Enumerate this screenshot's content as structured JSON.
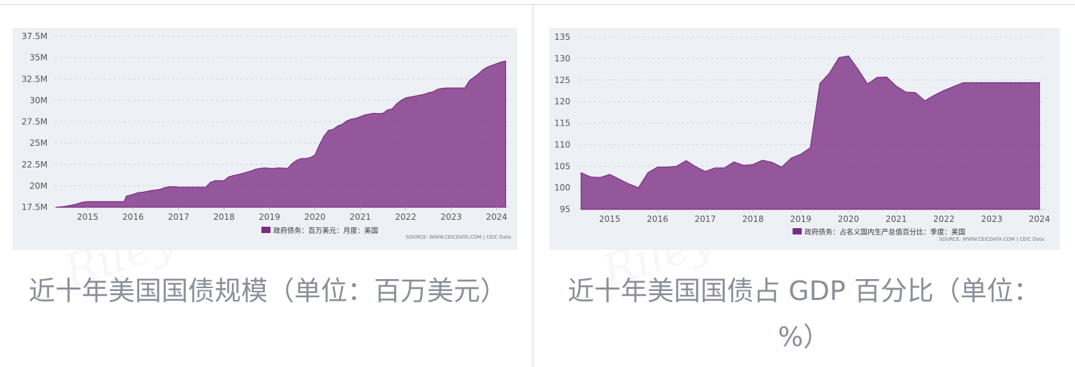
{
  "watermark": "Riley",
  "charts": [
    {
      "caption": "近十年美国国债规模（单位：百万美元）",
      "legend": "政府债务：百万美元：月度：美国",
      "source": "SOURCE: WWW.CEICDATA.COM | CEIC Data",
      "color": "#7b2b82",
      "chart_data": {
        "type": "area",
        "yticks": [
          "17.5M",
          "20M",
          "22.5M",
          "25M",
          "27.5M",
          "30M",
          "32.5M",
          "35M",
          "37.5M"
        ],
        "ytick_values": [
          17.5,
          20,
          22.5,
          25,
          27.5,
          30,
          32.5,
          35,
          37.5
        ],
        "xticks": [
          "2015",
          "2016",
          "2017",
          "2018",
          "2019",
          "2020",
          "2021",
          "2022",
          "2023",
          "2024"
        ],
        "ylim": [
          17.5,
          37.5
        ],
        "xlim": [
          2014.27,
          2024.3
        ],
        "x": [
          2014.3,
          2014.5,
          2014.7,
          2014.8,
          2014.9,
          2015.0,
          2015.1,
          2015.3,
          2015.5,
          2015.7,
          2015.8,
          2015.85,
          2016.0,
          2016.1,
          2016.2,
          2016.4,
          2016.6,
          2016.7,
          2016.8,
          2016.9,
          2017.0,
          2017.1,
          2017.3,
          2017.5,
          2017.6,
          2017.7,
          2017.8,
          2017.9,
          2018.0,
          2018.1,
          2018.2,
          2018.3,
          2018.5,
          2018.6,
          2018.7,
          2018.8,
          2018.9,
          2019.0,
          2019.1,
          2019.2,
          2019.4,
          2019.5,
          2019.6,
          2019.7,
          2019.8,
          2019.9,
          2020.0,
          2020.1,
          2020.2,
          2020.3,
          2020.4,
          2020.5,
          2020.6,
          2020.7,
          2020.8,
          2020.9,
          2021.0,
          2021.1,
          2021.2,
          2021.3,
          2021.4,
          2021.5,
          2021.6,
          2021.7,
          2021.8,
          2021.9,
          2022.0,
          2022.1,
          2022.2,
          2022.3,
          2022.4,
          2022.5,
          2022.6,
          2022.7,
          2022.8,
          2022.9,
          2023.0,
          2023.1,
          2023.2,
          2023.3,
          2023.4,
          2023.5,
          2023.6,
          2023.7,
          2023.8,
          2023.9,
          2024.0,
          2024.1,
          2024.2
        ],
        "y": [
          17.5,
          17.6,
          17.8,
          17.95,
          18.1,
          18.15,
          18.15,
          18.15,
          18.15,
          18.15,
          18.15,
          18.8,
          19.0,
          19.2,
          19.25,
          19.45,
          19.6,
          19.8,
          19.9,
          19.9,
          19.85,
          19.85,
          19.85,
          19.85,
          19.85,
          20.4,
          20.6,
          20.6,
          20.6,
          21.05,
          21.2,
          21.3,
          21.6,
          21.75,
          21.95,
          22.05,
          22.1,
          22.05,
          22.05,
          22.1,
          22.05,
          22.6,
          23.0,
          23.2,
          23.2,
          23.3,
          23.6,
          24.8,
          25.8,
          26.5,
          26.6,
          27.0,
          27.2,
          27.6,
          27.8,
          27.9,
          28.1,
          28.3,
          28.4,
          28.5,
          28.45,
          28.5,
          28.9,
          29.0,
          29.6,
          30.0,
          30.3,
          30.4,
          30.5,
          30.6,
          30.7,
          30.9,
          31.0,
          31.3,
          31.4,
          31.45,
          31.45,
          31.45,
          31.45,
          31.45,
          32.3,
          32.7,
          33.1,
          33.6,
          33.9,
          34.1,
          34.3,
          34.5,
          34.6
        ]
      }
    },
    {
      "caption": "近十年美国国债占 GDP 百分比（单位：%）",
      "legend": "政府债务：占名义国内生产总值百分比：季度：美国",
      "source": "SOURCE: WWW.CEICDATA.COM | CEIC Data",
      "color": "#7b2b82",
      "chart_data": {
        "type": "area",
        "yticks": [
          "95",
          "100",
          "105",
          "110",
          "115",
          "120",
          "125",
          "130",
          "135"
        ],
        "ytick_values": [
          95,
          100,
          105,
          110,
          115,
          120,
          125,
          130,
          135
        ],
        "xticks": [
          "2015",
          "2016",
          "2017",
          "2018",
          "2019",
          "2020",
          "2021",
          "2022",
          "2023",
          "2024"
        ],
        "ylim": [
          95,
          135
        ],
        "xlim": [
          2014.35,
          2024.1
        ],
        "x": [
          2014.4,
          2014.6,
          2014.8,
          2015.0,
          2015.2,
          2015.4,
          2015.6,
          2015.8,
          2016.0,
          2016.2,
          2016.4,
          2016.6,
          2016.8,
          2017.0,
          2017.2,
          2017.4,
          2017.6,
          2017.8,
          2018.0,
          2018.2,
          2018.4,
          2018.6,
          2018.8,
          2019.0,
          2019.2,
          2019.4,
          2019.6,
          2019.8,
          2020.0,
          2020.2,
          2020.4,
          2020.6,
          2020.8,
          2021.0,
          2021.2,
          2021.4,
          2021.6,
          2021.8,
          2022.0,
          2022.2,
          2022.4,
          2022.6,
          2022.8,
          2023.0,
          2023.2,
          2023.4,
          2023.6,
          2023.8,
          2024.0
        ],
        "y": [
          103.5,
          102.5,
          102.4,
          103.1,
          102.0,
          100.9,
          100.0,
          103.5,
          104.8,
          104.8,
          105.0,
          106.3,
          104.9,
          103.8,
          104.6,
          104.6,
          106.0,
          105.2,
          105.4,
          106.4,
          105.9,
          104.8,
          106.9,
          107.8,
          109.3,
          124.2,
          126.6,
          130.2,
          130.6,
          127.5,
          124.1,
          125.6,
          125.7,
          123.6,
          122.2,
          122.1,
          120.2,
          121.5,
          122.6,
          123.5,
          124.4,
          124.4,
          124.4,
          124.4,
          124.4,
          124.4,
          124.4,
          124.4,
          124.4
        ]
      }
    }
  ]
}
